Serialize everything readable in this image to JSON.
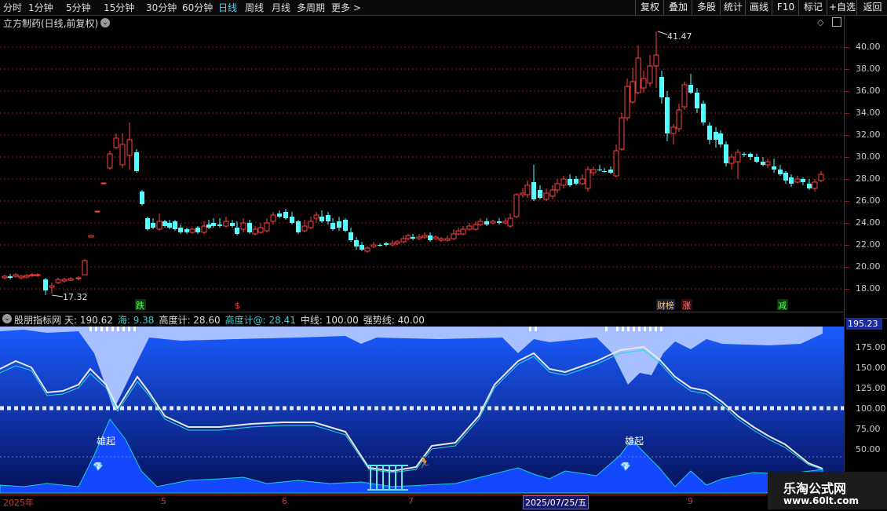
{
  "toolbar": {
    "periods": [
      "分时",
      "1分钟",
      "5分钟",
      "15分钟",
      "30分钟",
      "60分钟",
      "日线",
      "周线",
      "月线",
      "多周期",
      "更多 >"
    ],
    "active_period": "日线",
    "actions": [
      "复权",
      "叠加",
      "多股",
      "统计",
      "画线",
      "F10",
      "标记",
      "+自选",
      "返回"
    ]
  },
  "chart_title": "立方制药(日线,前复权)",
  "price_axis": {
    "labels": [
      "40.00",
      "38.00",
      "36.00",
      "34.00",
      "32.00",
      "30.00",
      "28.00",
      "26.00",
      "24.00",
      "22.00",
      "20.00",
      "18.00"
    ]
  },
  "annotations": {
    "high": "41.47",
    "low": "17.32",
    "markers": [
      "跌",
      "$",
      "财榜",
      "涨",
      "减"
    ]
  },
  "indicator": {
    "name": "股朋指标网",
    "fields": [
      {
        "label": "天:",
        "value": "190.62",
        "color": "#dddddd"
      },
      {
        "label": "海:",
        "value": "9.38",
        "color": "#3ec8c8"
      },
      {
        "label": "高度计:",
        "value": "28.60",
        "color": "#dddddd"
      },
      {
        "label": "高度计@:",
        "value": "28.41",
        "color": "#3ec8c8"
      },
      {
        "label": "中线:",
        "value": "100.00",
        "color": "#dddddd"
      },
      {
        "label": "强势线:",
        "value": "40.00",
        "color": "#dddddd"
      }
    ],
    "current_value": "195.23",
    "axis_labels": [
      "175.00",
      "150.00",
      "125.00",
      "100.00",
      "75.00",
      "50.00"
    ],
    "labels": [
      "雄起",
      "雄起"
    ]
  },
  "date_bar": {
    "labels": [
      "2025年",
      "5",
      "6",
      "7",
      "2025/07/25/五",
      "9"
    ]
  },
  "watermark": {
    "line1": "乐淘公式网",
    "line2": "www.60lt.com"
  },
  "colors": {
    "up": "#ff4040",
    "down": "#54ffff",
    "grid": "#8b1a1a",
    "indicator_fill_top": "#2d6cff",
    "indicator_fill_bottom": "#0a1a80"
  }
}
